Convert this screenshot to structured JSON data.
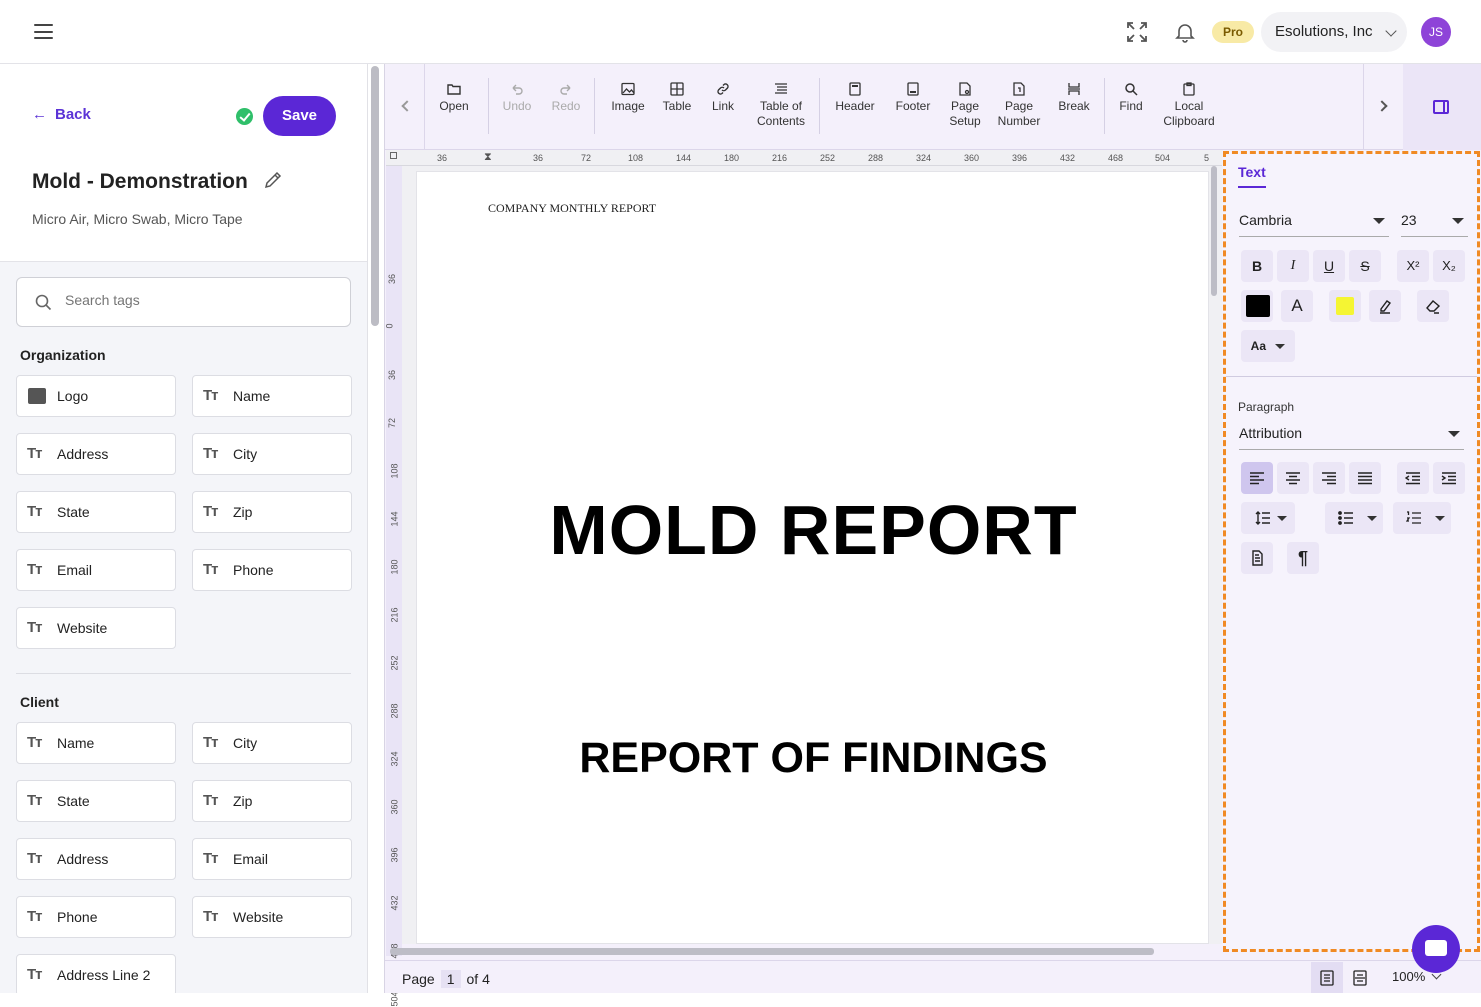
{
  "topbar": {
    "pro_badge": "Pro",
    "org_name": "Esolutions, Inc",
    "avatar_initials": "JS"
  },
  "left": {
    "back_label": "Back",
    "save_label": "Save",
    "doc_title": "Mold - Demonstration",
    "doc_subtitle": "Micro Air, Micro Swab, Micro Tape",
    "search_placeholder": "Search tags",
    "groups": [
      {
        "title": "Organization",
        "tags": [
          {
            "label": "Logo",
            "icon": "image-icon"
          },
          {
            "label": "Name",
            "icon": "text-icon"
          },
          {
            "label": "Address",
            "icon": "text-icon"
          },
          {
            "label": "City",
            "icon": "text-icon"
          },
          {
            "label": "State",
            "icon": "text-icon"
          },
          {
            "label": "Zip",
            "icon": "text-icon"
          },
          {
            "label": "Email",
            "icon": "text-icon"
          },
          {
            "label": "Phone",
            "icon": "text-icon"
          },
          {
            "label": "Website",
            "icon": "text-icon"
          }
        ]
      },
      {
        "title": "Client",
        "tags": [
          {
            "label": "Name",
            "icon": "text-icon"
          },
          {
            "label": "City",
            "icon": "text-icon"
          },
          {
            "label": "State",
            "icon": "text-icon"
          },
          {
            "label": "Zip",
            "icon": "text-icon"
          },
          {
            "label": "Address",
            "icon": "text-icon"
          },
          {
            "label": "Email",
            "icon": "text-icon"
          },
          {
            "label": "Phone",
            "icon": "text-icon"
          },
          {
            "label": "Website",
            "icon": "text-icon"
          },
          {
            "label": "Address Line 2",
            "icon": "text-icon"
          }
        ]
      }
    ]
  },
  "toolbar": {
    "open": "Open",
    "undo": "Undo",
    "redo": "Redo",
    "image": "Image",
    "table": "Table",
    "link": "Link",
    "toc_1": "Table of",
    "toc_2": "Contents",
    "header": "Header",
    "footer": "Footer",
    "page_setup_1": "Page",
    "page_setup_2": "Setup",
    "page_number_1": "Page",
    "page_number_2": "Number",
    "break": "Break",
    "find": "Find",
    "clipboard_1": "Local",
    "clipboard_2": "Clipboard"
  },
  "ruler": {
    "h_ticks": [
      "36",
      "36",
      "72",
      "108",
      "144",
      "180",
      "216",
      "252",
      "288",
      "324",
      "360",
      "396",
      "432",
      "468",
      "504",
      "5"
    ],
    "v_ticks": [
      "36",
      "0",
      "36",
      "72",
      "108",
      "144",
      "180",
      "216",
      "252",
      "288",
      "324",
      "360",
      "396",
      "432",
      "468",
      "504"
    ]
  },
  "document": {
    "header_text": "COMPANY MONTHLY REPORT",
    "title": "MOLD REPORT",
    "subtitle": "REPORT OF FINDINGS"
  },
  "status": {
    "page_label": "Page",
    "page_current": "1",
    "page_of": "of 4",
    "zoom": "100%"
  },
  "panel": {
    "tab_text": "Text",
    "font_family": "Cambria",
    "font_size": "23",
    "bold": "B",
    "italic": "I",
    "underline": "U",
    "strike": "S",
    "superscript": "X²",
    "subscript": "X₂",
    "font_color_glyph": "A",
    "case_label": "Aa",
    "font_color": "#000000",
    "highlight_color": "#f5f533",
    "paragraph_label": "Paragraph",
    "paragraph_style": "Attribution",
    "pilcrow": "¶"
  }
}
